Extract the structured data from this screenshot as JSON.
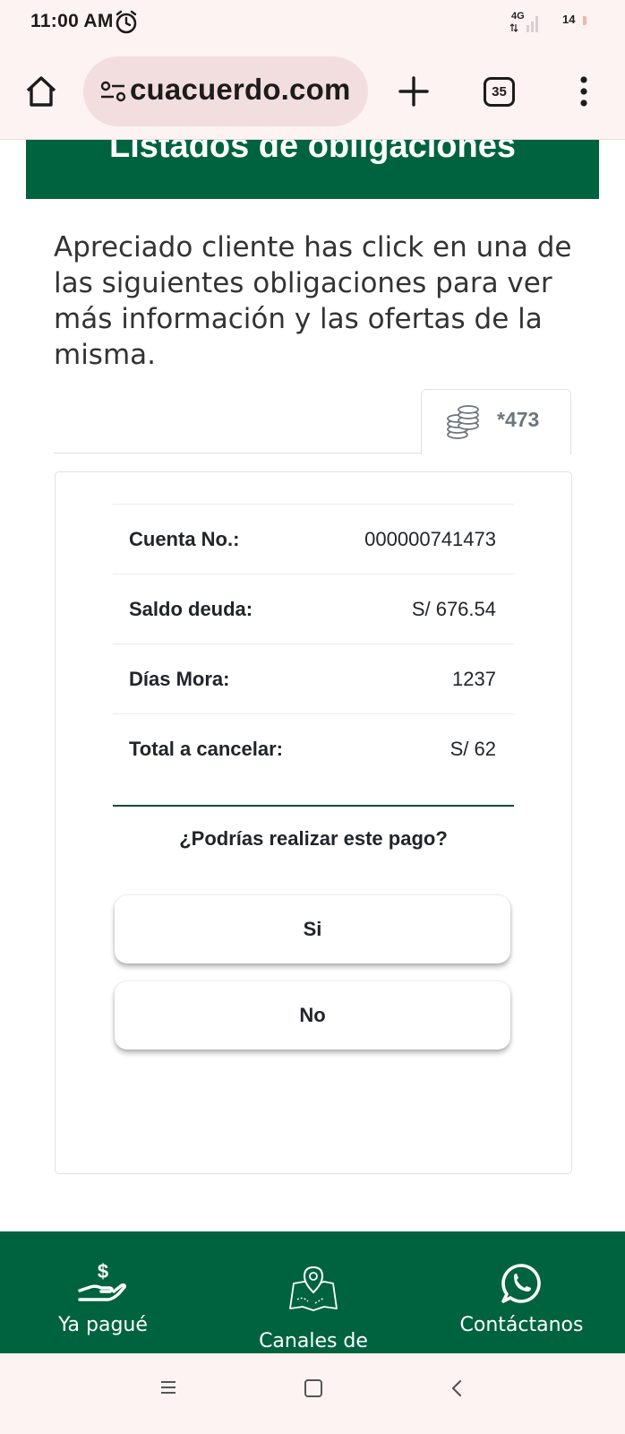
{
  "status_bar": {
    "time": "11:00 AM",
    "network": "4G",
    "battery": "14"
  },
  "browser": {
    "url": "cuacuerdo.com",
    "tab_count": "35"
  },
  "page": {
    "title": "Listados de obligaciones",
    "intro": "Apreciado cliente has click en una de las siguientes obligaciones para ver más información y las ofertas de la misma.",
    "account_tab": "*473",
    "rows": [
      {
        "label": "Cuenta No.:",
        "value": "000000741473"
      },
      {
        "label": "Saldo deuda:",
        "value": "S/ 676.54"
      },
      {
        "label": "Días Mora:",
        "value": "1237"
      },
      {
        "label": "Total a cancelar:",
        "value": "S/ 62"
      }
    ],
    "question": "¿Podrías realizar este pago?",
    "yes_label": "Si",
    "no_label": "No"
  },
  "bottom_nav": {
    "items": [
      {
        "label": "Ya pagué",
        "icon": "hand-dollar-icon"
      },
      {
        "label": "Canales de",
        "icon": "map-pin-icon"
      },
      {
        "label": "Contáctanos",
        "icon": "whatsapp-icon"
      }
    ]
  },
  "colors": {
    "brand_green": "#006340",
    "chrome_bg": "#fdf3f3",
    "url_pill": "#f2dede"
  }
}
